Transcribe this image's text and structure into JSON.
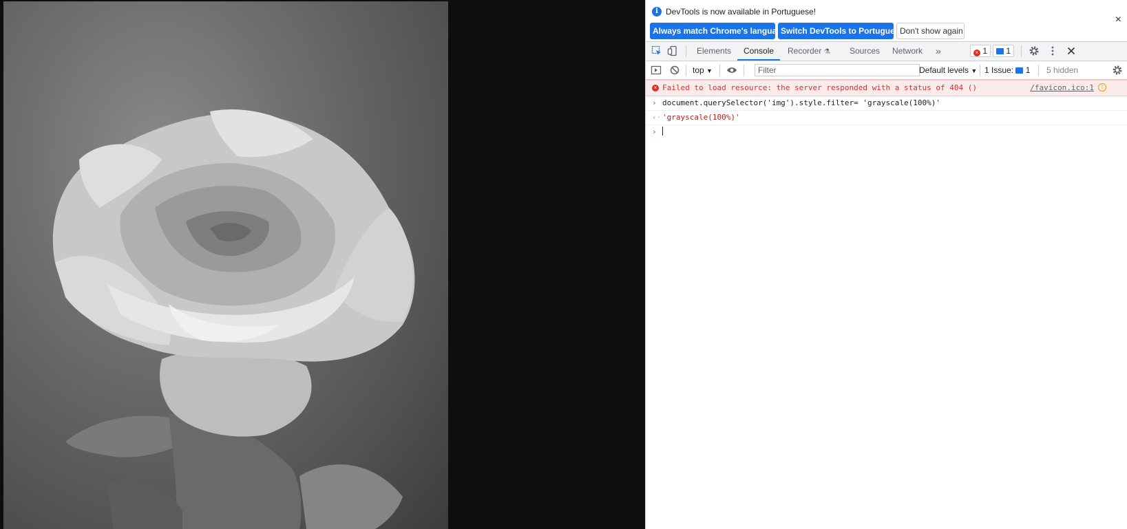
{
  "infobar": {
    "message": "DevTools is now available in Portuguese!",
    "btn_match": "Always match Chrome's language",
    "btn_switch": "Switch DevTools to Portuguese",
    "btn_dont_show": "Don't show again",
    "close": "×"
  },
  "tabs": {
    "elements": "Elements",
    "console": "Console",
    "recorder": "Recorder",
    "sources": "Sources",
    "network": "Network",
    "more": "»",
    "error_count": "1",
    "message_count": "1"
  },
  "console_toolbar": {
    "context": "top",
    "filter_placeholder": "Filter",
    "levels": "Default levels",
    "issues": "1 Issue:",
    "issues_count": "1",
    "hidden": "5 hidden"
  },
  "console": {
    "error_text": "Failed to load resource: the server responded with a status of 404 ()",
    "error_source": "/favicon.ico:1",
    "input_command": "document.querySelector('img').style.filter= 'grayscale(100%)'",
    "output_value": "'grayscale(100%)'"
  },
  "colors": {
    "accent": "#1a73e8",
    "error": "#d93025",
    "error_bg": "#fcebeb"
  }
}
